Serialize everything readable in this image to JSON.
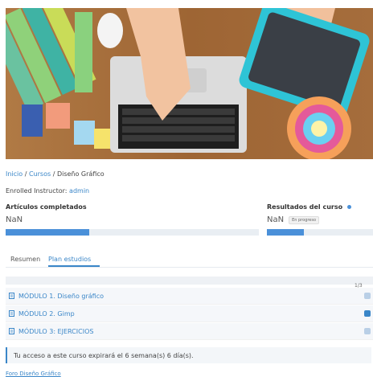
{
  "breadcrumb": {
    "home": "Inicio",
    "courses": "Cursos",
    "separator": "/",
    "current": "Diseño Gráfico"
  },
  "instructor": {
    "label": "Enrolled Instructor:",
    "name": "admin"
  },
  "articles": {
    "title": "Artículos completados",
    "value": "NaN",
    "progress_fraction": 0.33
  },
  "results": {
    "title": "Resultados del curso",
    "value": "NaN",
    "badge": "En progreso",
    "progress_fraction": 0.35
  },
  "tabs": {
    "summary": "Resumen",
    "plan": "Plan estudios"
  },
  "modules": {
    "ratio": "1/3",
    "items": [
      {
        "label": "MÓDULO 1. Diseño gráfico",
        "status": "dot"
      },
      {
        "label": "MÓDULO 2. Gimp",
        "status": "check"
      },
      {
        "label": "MÓDULO 3: EJERCICIOS",
        "status": "dot"
      }
    ]
  },
  "alert": {
    "text": "Tu acceso a este curso expirará el 6 semana(s) 6 día(s)."
  },
  "footer": {
    "link": "Foro Diseño Gráfico"
  },
  "colors": {
    "accent": "#3a86c8",
    "progress": "#4a90d9"
  }
}
